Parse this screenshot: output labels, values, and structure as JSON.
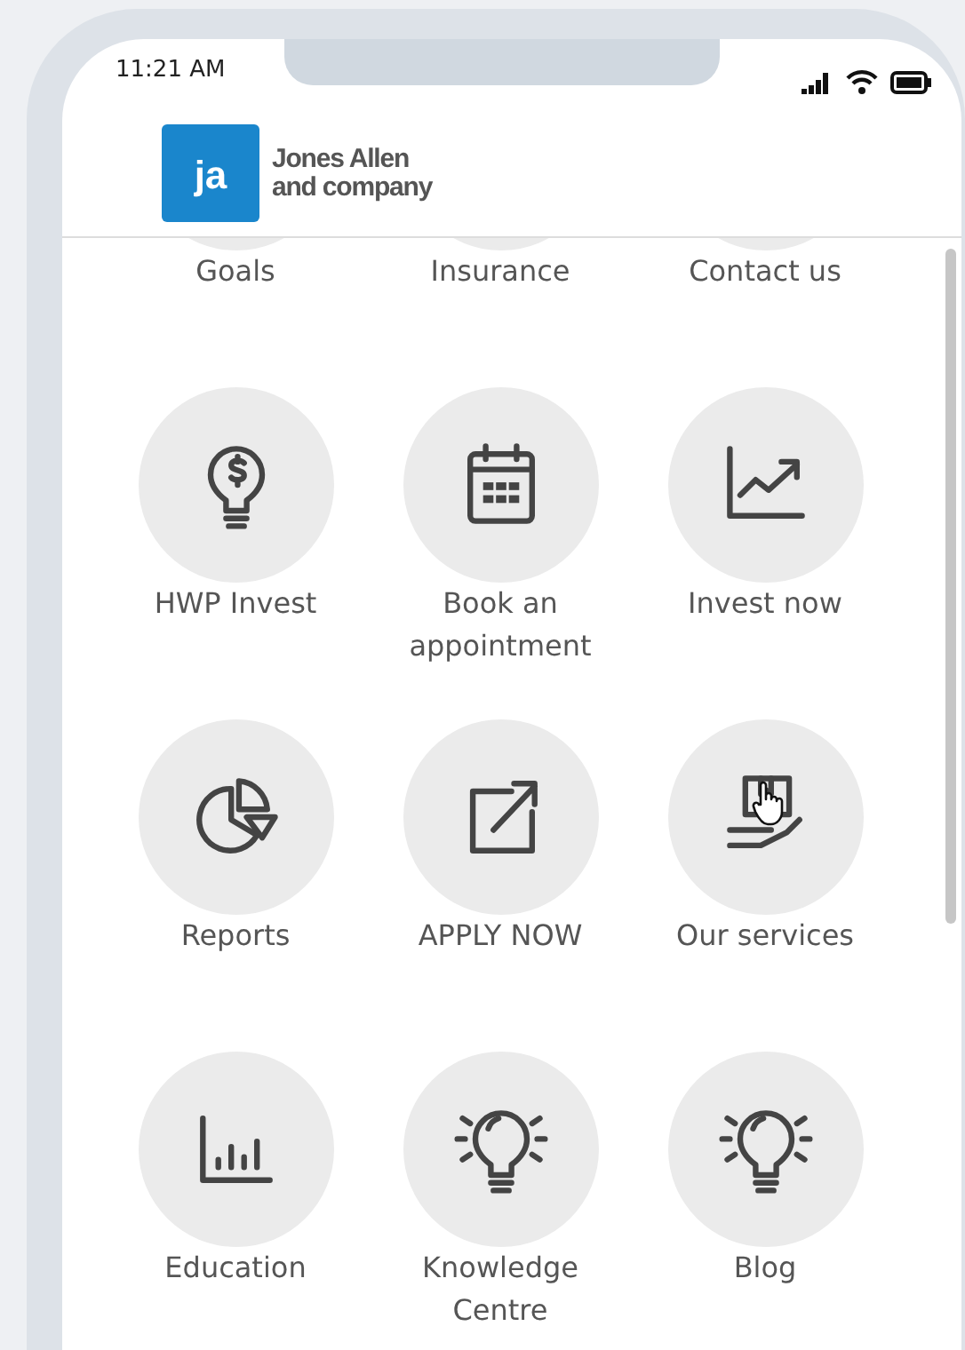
{
  "status_bar": {
    "time": "11:21 AM"
  },
  "header": {
    "logo_mark": "ja",
    "company_line_1": "Jones Allen",
    "company_line_2": "and company"
  },
  "tiles": [
    {
      "label": "Goals"
    },
    {
      "label": "Insurance"
    },
    {
      "label": "Contact us"
    },
    {
      "label": "HWP Invest"
    },
    {
      "label": "Book an appointment"
    },
    {
      "label": "Invest now"
    },
    {
      "label": "Reports"
    },
    {
      "label": "APPLY NOW"
    },
    {
      "label": "Our services",
      "hovered": true
    },
    {
      "label": "Education"
    },
    {
      "label": "Knowledge Centre"
    },
    {
      "label": "Blog"
    }
  ]
}
